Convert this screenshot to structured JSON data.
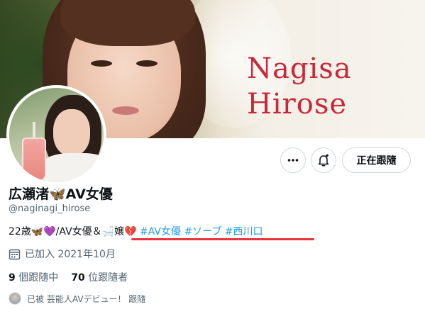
{
  "banner": {
    "title_line1": "Nagisa",
    "title_line2": "Hirose",
    "title_color": "#c8283a"
  },
  "avatar": {
    "icon": "profile-photo"
  },
  "actions": {
    "more_icon": "more-dots-icon",
    "bell_icon": "bell-plus-icon",
    "follow_label": "正在跟隨"
  },
  "profile": {
    "display_name": "広瀬渚🦋AV女優",
    "handle": "@naginagi_hirose",
    "bio_prefix": "22歳🦋💜/AV女優＆🛁嬢",
    "bio_heart": "💔",
    "bio_tags": [
      "#AV女優",
      "#ソープ",
      "#西川口"
    ],
    "joined_icon": "calendar-icon",
    "joined": "已加入 2021年10月"
  },
  "stats": {
    "following_count": "9",
    "following_label": "個跟隨中",
    "followers_count": "70",
    "followers_label": "位跟隨者"
  },
  "followed_by": {
    "text": "已被 芸能人AVデビュー！ 跟隨"
  },
  "colors": {
    "link": "#1d9bf0",
    "underline": "#e8343c",
    "muted": "#536471"
  }
}
